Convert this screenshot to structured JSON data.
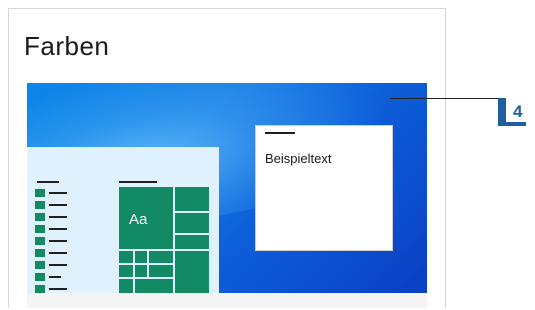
{
  "panel": {
    "title": "Farben"
  },
  "preview": {
    "tile_label": "Aa",
    "dialog_text": "Beispieltext",
    "accent_color": "#128a63",
    "background_color": "#0d5fd9"
  },
  "callout": {
    "number": "4"
  }
}
